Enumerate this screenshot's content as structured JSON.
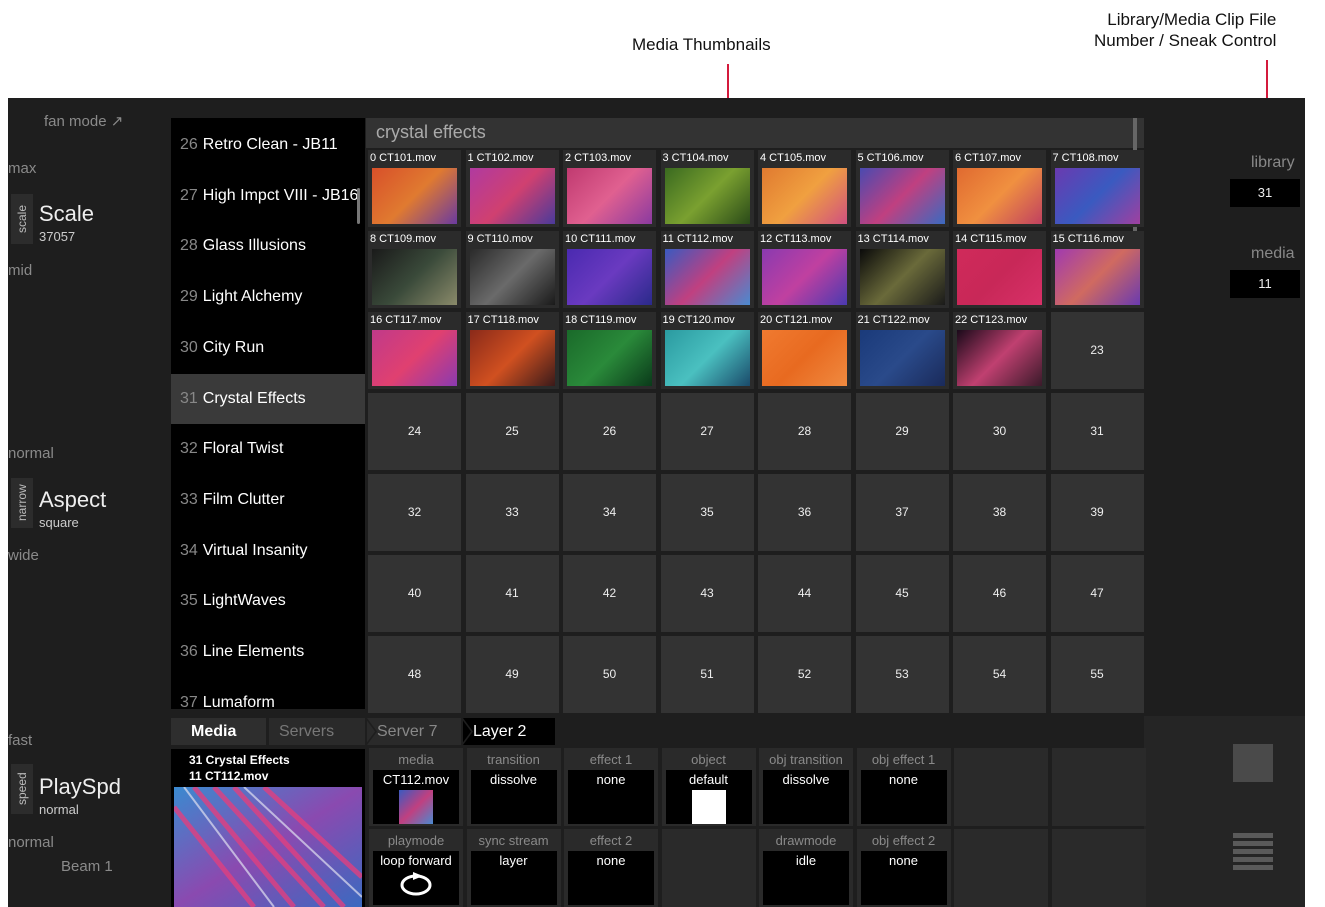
{
  "callouts": {
    "media_thumbnails": "Media Thumbnails",
    "library_line1": "Library/Media Clip File",
    "library_line2": "Number / Sneak Control"
  },
  "left": {
    "fan_mode": "fan mode ↗",
    "scale": {
      "top": "max",
      "vlabel": "scale",
      "title": "Scale",
      "value": "37057",
      "bottom": "mid"
    },
    "aspect": {
      "top": "normal",
      "vlabel": "narrow",
      "title": "Aspect",
      "value": "square",
      "bottom": "wide"
    },
    "playspd": {
      "top": "fast",
      "vlabel": "speed",
      "title": "PlaySpd",
      "value": "normal",
      "bottom": "normal"
    },
    "beam": "Beam 1"
  },
  "library_list": [
    {
      "num": "26",
      "name": "Retro Clean - JB11"
    },
    {
      "num": "27",
      "name": "High Impct VIII - JB16"
    },
    {
      "num": "28",
      "name": "Glass Illusions"
    },
    {
      "num": "29",
      "name": "Light Alchemy"
    },
    {
      "num": "30",
      "name": "City Run"
    },
    {
      "num": "31",
      "name": "Crystal Effects"
    },
    {
      "num": "32",
      "name": "Floral Twist"
    },
    {
      "num": "33",
      "name": "Film Clutter"
    },
    {
      "num": "34",
      "name": "Virtual Insanity"
    },
    {
      "num": "35",
      "name": "LightWaves"
    },
    {
      "num": "36",
      "name": "Line Elements"
    },
    {
      "num": "37",
      "name": "Lumaform"
    }
  ],
  "library_selected": "31",
  "grid": {
    "title": "crystal effects",
    "thumbs": [
      {
        "label": "0 CT101.mov",
        "colors": [
          "#d8502a",
          "#e07a30",
          "#6a3aa0"
        ]
      },
      {
        "label": "1 CT102.mov",
        "colors": [
          "#b03aa0",
          "#d04070",
          "#4a3a9a"
        ]
      },
      {
        "label": "2 CT103.mov",
        "colors": [
          "#c03a70",
          "#e06090",
          "#8a3aa0"
        ]
      },
      {
        "label": "3 CT104.mov",
        "colors": [
          "#3a6a20",
          "#7aa030",
          "#2a4a18"
        ]
      },
      {
        "label": "4 CT105.mov",
        "colors": [
          "#e07a30",
          "#f0a040",
          "#d05080"
        ]
      },
      {
        "label": "5 CT106.mov",
        "colors": [
          "#4a4ab0",
          "#c04080",
          "#3a6ac0"
        ]
      },
      {
        "label": "6 CT107.mov",
        "colors": [
          "#e06a30",
          "#f09040",
          "#c04060"
        ]
      },
      {
        "label": "7 CT108.mov",
        "colors": [
          "#6a3ab0",
          "#3a5ac0",
          "#a040a0"
        ]
      },
      {
        "label": "8 CT109.mov",
        "colors": [
          "#1a1a1a",
          "#3a4a3a",
          "#8a8a6a"
        ]
      },
      {
        "label": "9 CT110.mov",
        "colors": [
          "#2a2a2a",
          "#6a6a6a",
          "#1a1a1a"
        ]
      },
      {
        "label": "10 CT111.mov",
        "colors": [
          "#4a2ab0",
          "#6a3ac0",
          "#2a2a8a"
        ]
      },
      {
        "label": "11 CT112.mov",
        "colors": [
          "#3a5ac0",
          "#c04080",
          "#4a8ad0"
        ]
      },
      {
        "label": "12 CT113.mov",
        "colors": [
          "#8a3ab0",
          "#c040a0",
          "#4a3ab0"
        ]
      },
      {
        "label": "13 CT114.mov",
        "colors": [
          "#0a0a0a",
          "#6a6a3a",
          "#1a1a1a"
        ]
      },
      {
        "label": "14 CT115.mov",
        "colors": [
          "#d02a5a",
          "#c82858",
          "#d83068"
        ]
      },
      {
        "label": "15 CT116.mov",
        "colors": [
          "#a03ab0",
          "#d06a60",
          "#6a3ab0"
        ]
      },
      {
        "label": "16 CT117.mov",
        "colors": [
          "#c03a8a",
          "#e04070",
          "#8a3ab0"
        ]
      },
      {
        "label": "17 CT118.mov",
        "colors": [
          "#8a2a1a",
          "#d05020",
          "#3a1a1a"
        ]
      },
      {
        "label": "18 CT119.mov",
        "colors": [
          "#1a6a2a",
          "#2a8a3a",
          "#0a3a1a"
        ]
      },
      {
        "label": "19 CT120.mov",
        "colors": [
          "#2a9aa0",
          "#4ac0c0",
          "#1a4a6a"
        ]
      },
      {
        "label": "20 CT121.mov",
        "colors": [
          "#f07a30",
          "#e86a20",
          "#f08a40"
        ]
      },
      {
        "label": "21 CT122.mov",
        "colors": [
          "#1a3a7a",
          "#2a4a8a",
          "#1a2a5a"
        ]
      },
      {
        "label": "22 CT123.mov",
        "colors": [
          "#1a0a1a",
          "#c04070",
          "#3a1a2a"
        ]
      }
    ],
    "empty_slots": [
      "23",
      "24",
      "25",
      "26",
      "27",
      "28",
      "29",
      "30",
      "31",
      "32",
      "33",
      "34",
      "35",
      "36",
      "37",
      "38",
      "39",
      "40",
      "41",
      "42",
      "43",
      "44",
      "45",
      "46",
      "47",
      "48",
      "49",
      "50",
      "51",
      "52",
      "53",
      "54",
      "55"
    ]
  },
  "right": {
    "library_label": "library",
    "library_value": "31",
    "media_label": "media",
    "media_value": "11"
  },
  "tabs": {
    "media": "Media",
    "servers": "Servers",
    "server": "Server 7",
    "layer": "Layer 2"
  },
  "preview": {
    "line1": "31 Crystal Effects",
    "line2": "11 CT112.mov"
  },
  "params_row1": [
    {
      "label": "media",
      "value": "CT112.mov"
    },
    {
      "label": "transition",
      "value": "dissolve"
    },
    {
      "label": "effect 1",
      "value": "none"
    },
    {
      "label": "object",
      "value": "default"
    },
    {
      "label": "obj transition",
      "value": "dissolve"
    },
    {
      "label": "obj effect 1",
      "value": "none"
    }
  ],
  "params_row2": [
    {
      "label": "playmode",
      "value": "loop forward"
    },
    {
      "label": "sync stream",
      "value": "layer"
    },
    {
      "label": "effect 2",
      "value": "none"
    },
    {
      "label": "",
      "value": ""
    },
    {
      "label": "drawmode",
      "value": "idle"
    },
    {
      "label": "obj effect 2",
      "value": "none"
    }
  ],
  "colors": {
    "accent_arrow": "#d41a3c",
    "panel": "#1e1e1e",
    "cell": "#333333"
  }
}
